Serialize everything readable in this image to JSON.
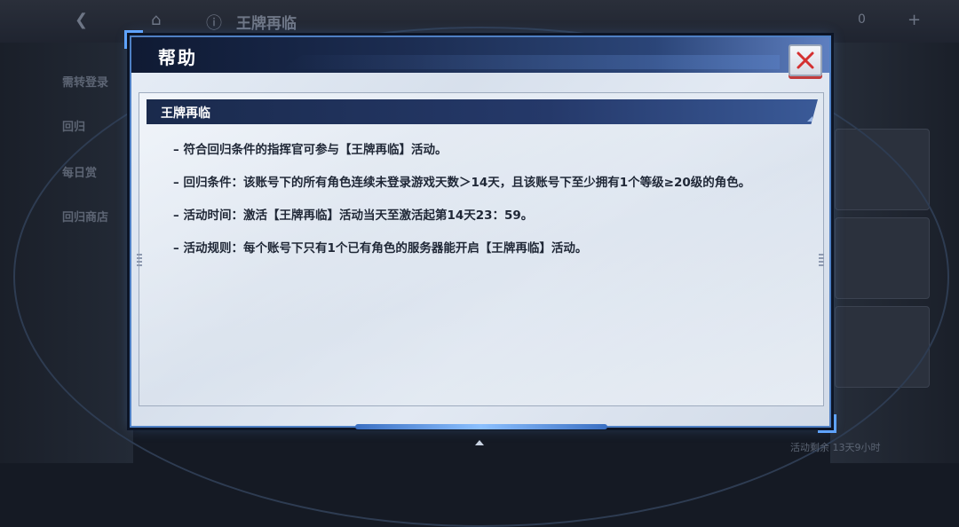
{
  "background": {
    "page_title": "王牌再临",
    "left_items": [
      "需转登录",
      "回归",
      "每日赏",
      "回归商店"
    ],
    "bottom_info": "活动剩余 13天9小时",
    "counter_right": "0"
  },
  "dialog": {
    "title": "帮助",
    "section_title": "王牌再临",
    "rules": [
      "– 符合回归条件的指挥官可参与【王牌再临】活动。",
      "– 回归条件：该账号下的所有角色连续未登录游戏天数＞14天，且该账号下至少拥有1个等级≥20级的角色。",
      "– 活动时间：激活【王牌再临】活动当天至激活起第14天23：59。",
      "– 活动规则：每个账号下只有1个已有角色的服务器能开启【王牌再临】活动。"
    ],
    "close_icon": "close-x-icon"
  },
  "colors": {
    "header_dark": "#0f1a33",
    "accent_blue": "#4f80c4",
    "close_red": "#c23b3b"
  }
}
